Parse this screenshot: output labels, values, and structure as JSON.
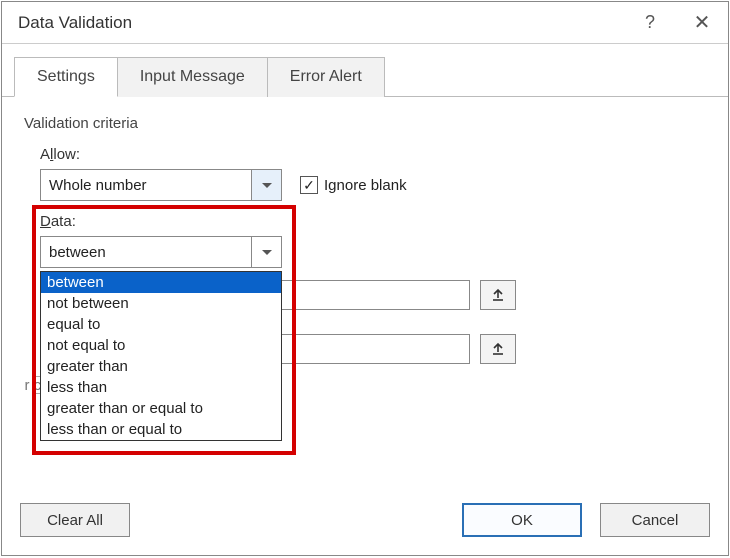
{
  "window": {
    "title": "Data Validation",
    "help_symbol": "?",
    "close_symbol": "✕"
  },
  "tabs": {
    "settings": "Settings",
    "input_message": "Input Message",
    "error_alert": "Error Alert",
    "active": "settings"
  },
  "criteria": {
    "group_label": "Validation criteria",
    "allow_label_pre": "A",
    "allow_label_ul": "l",
    "allow_label_post": "low:",
    "allow_value": "Whole number",
    "ignore_blank_pre": "Ignore ",
    "ignore_blank_ul": "b",
    "ignore_blank_post": "lank",
    "ignore_blank_checked": true,
    "data_label_ul": "D",
    "data_label_post": "ata:",
    "data_value": "between",
    "data_options": [
      "between",
      "not between",
      "equal to",
      "not equal to",
      "greater than",
      "less than",
      "greater than or equal to",
      "less than or equal to"
    ],
    "data_selected_index": 0,
    "apply_label": "r cells with the same settings"
  },
  "buttons": {
    "clear_all": "Clear All",
    "ok": "OK",
    "cancel": "Cancel"
  }
}
